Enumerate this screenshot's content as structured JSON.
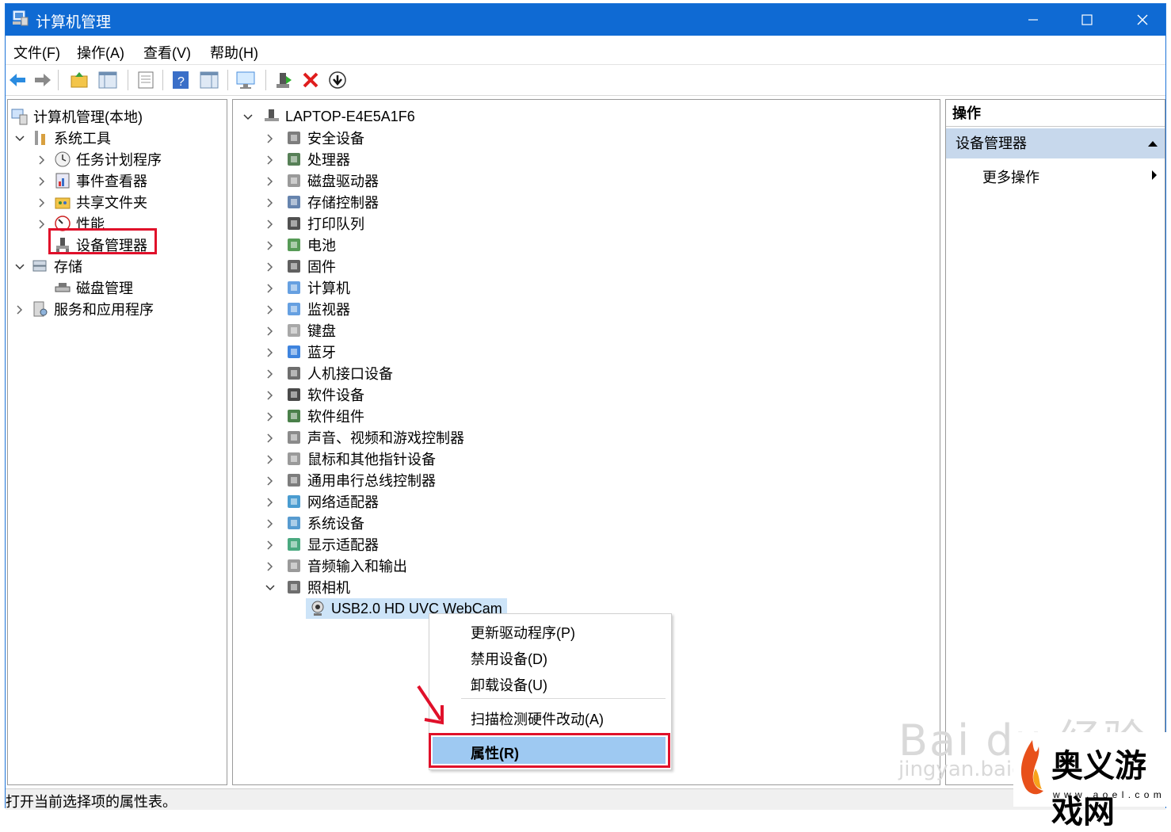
{
  "window": {
    "title": "计算机管理"
  },
  "menu": [
    "文件(F)",
    "操作(A)",
    "查看(V)",
    "帮助(H)"
  ],
  "left_tree": [
    {
      "label": "计算机管理(本地)",
      "icon": "computer-management-icon"
    },
    {
      "label": "系统工具",
      "icon": "tools-icon"
    },
    {
      "label": "任务计划程序",
      "icon": "clock-icon"
    },
    {
      "label": "事件查看器",
      "icon": "event-viewer-icon"
    },
    {
      "label": "共享文件夹",
      "icon": "shared-folder-icon"
    },
    {
      "label": "性能",
      "icon": "performance-icon"
    },
    {
      "label": "设备管理器",
      "icon": "device-manager-icon"
    },
    {
      "label": "存储",
      "icon": "storage-icon"
    },
    {
      "label": "磁盘管理",
      "icon": "disk-icon"
    },
    {
      "label": "服务和应用程序",
      "icon": "services-icon"
    }
  ],
  "device_tree": {
    "root": "LAPTOP-E4E5A1F6",
    "categories": [
      "安全设备",
      "处理器",
      "磁盘驱动器",
      "存储控制器",
      "打印队列",
      "电池",
      "固件",
      "计算机",
      "监视器",
      "键盘",
      "蓝牙",
      "人机接口设备",
      "软件设备",
      "软件组件",
      "声音、视频和游戏控制器",
      "鼠标和其他指针设备",
      "通用串行总线控制器",
      "网络适配器",
      "系统设备",
      "显示适配器",
      "音频输入和输出",
      "照相机"
    ],
    "selected_device": "USB2.0 HD UVC WebCam"
  },
  "actions": {
    "header": "操作",
    "section": "设备管理器",
    "more": "更多操作"
  },
  "context_menu": [
    "更新驱动程序(P)",
    "禁用设备(D)",
    "卸载设备(U)",
    "扫描检测硬件改动(A)",
    "属性(R)"
  ],
  "status": "打开当前选择项的属性表。",
  "watermark": {
    "baidu": "Bai du 经验",
    "baidu_url": "jingyan.baidu.com",
    "brand": "奥义游戏网",
    "brand_url": "w w w . a o e l . c o m"
  },
  "colors": {
    "titlebar": "#0f6ad3",
    "highlight": "#e0102a",
    "selected": "#9ec9f2"
  }
}
